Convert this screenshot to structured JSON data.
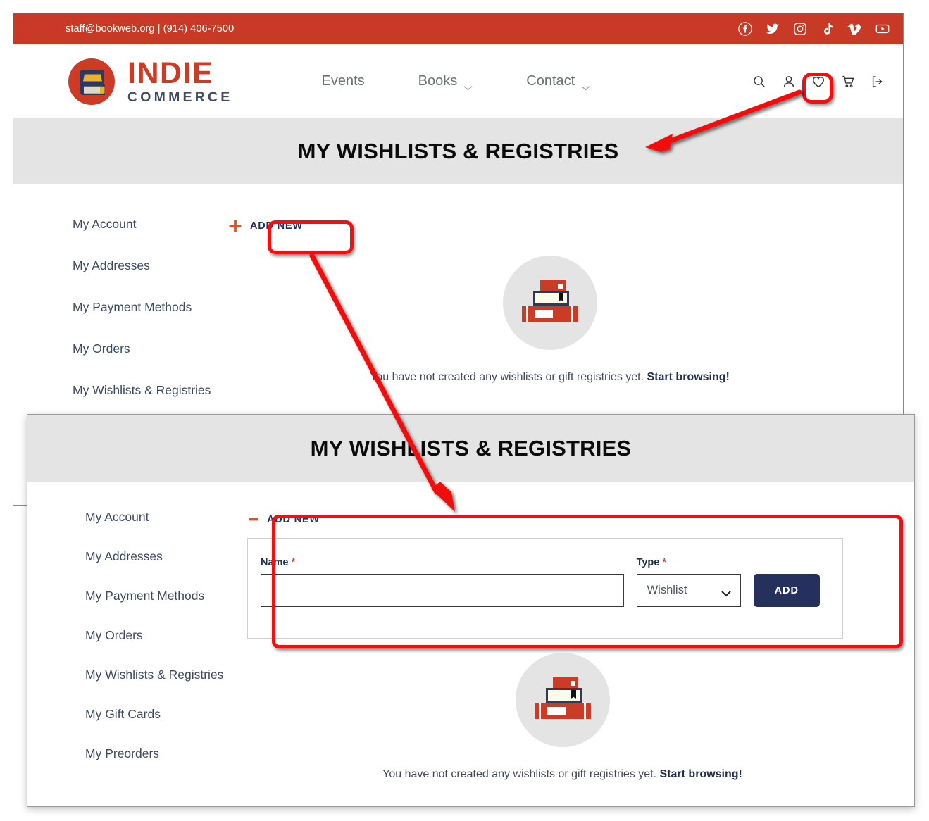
{
  "topbar": {
    "contact": "staff@bookweb.org | (914) 406-7500",
    "social": [
      {
        "name": "facebook-icon",
        "label": "Facebook"
      },
      {
        "name": "twitter-icon",
        "label": "Twitter"
      },
      {
        "name": "instagram-icon",
        "label": "Instagram"
      },
      {
        "name": "tiktok-icon",
        "label": "TikTok"
      },
      {
        "name": "vimeo-icon",
        "label": "Vimeo"
      },
      {
        "name": "youtube-icon",
        "label": "YouTube"
      }
    ],
    "bg_color": "#c93a26"
  },
  "brand": {
    "name_top": "INDIE",
    "name_bottom": "COMMERCE",
    "color_primary": "#cc3b26",
    "color_secondary": "#404c60",
    "color_accent": "#e8b42c"
  },
  "nav": {
    "items": [
      {
        "label": "Events",
        "has_dropdown": false
      },
      {
        "label": "Books",
        "has_dropdown": true
      },
      {
        "label": "Contact",
        "has_dropdown": true
      }
    ]
  },
  "header_icons": [
    {
      "name": "search-icon",
      "label": "Search"
    },
    {
      "name": "user-icon",
      "label": "My Account"
    },
    {
      "name": "heart-icon",
      "label": "Wishlists"
    },
    {
      "name": "cart-icon",
      "label": "Cart"
    },
    {
      "name": "logout-icon",
      "label": "Log out"
    }
  ],
  "page": {
    "title": "MY WISHLISTS & REGISTRIES",
    "title_bg": "#e4e4e4"
  },
  "sidebar_upper": {
    "items": [
      {
        "label": "My Account"
      },
      {
        "label": "My Addresses"
      },
      {
        "label": "My Payment Methods"
      },
      {
        "label": "My Orders"
      },
      {
        "label": "My Wishlists & Registries"
      }
    ]
  },
  "sidebar_lower": {
    "items": [
      {
        "label": "My Account"
      },
      {
        "label": "My Addresses"
      },
      {
        "label": "My Payment Methods"
      },
      {
        "label": "My Orders"
      },
      {
        "label": "My Wishlists & Registries"
      },
      {
        "label": "My Gift Cards"
      },
      {
        "label": "My Preorders"
      }
    ]
  },
  "add_new": {
    "label_collapsed": "ADD NEW",
    "label_expanded": "ADD NEW",
    "toggle_icon_collapsed": "plus-icon",
    "toggle_icon_expanded": "minus-icon"
  },
  "form": {
    "name_label": "Name",
    "name_required_mark": "*",
    "name_value": "",
    "name_placeholder": "",
    "type_label": "Type",
    "type_required_mark": "*",
    "type_selected": "Wishlist",
    "type_options": [
      "Wishlist"
    ],
    "submit_label": "ADD",
    "submit_color": "#25305c"
  },
  "empty_state": {
    "message": "You have not created any wishlists or gift registries yet.",
    "link": "Start browsing!",
    "illustration": "book-stack-icon"
  },
  "annotations": {
    "color": "#f20f0f",
    "highlight_heart_icon": true,
    "highlight_add_new_button": true,
    "highlight_form_box": true,
    "arrows": 2
  }
}
